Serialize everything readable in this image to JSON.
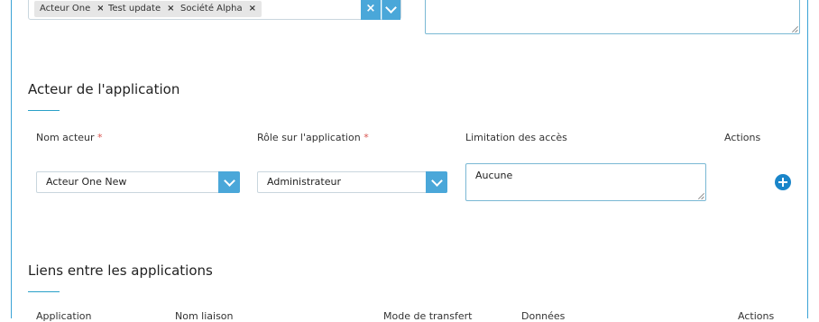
{
  "top": {
    "tags": [
      "Acteur One",
      "Test update",
      "Société Alpha"
    ],
    "tag_remove": "×"
  },
  "actors_section": {
    "title": "Acteur de l'application",
    "headers": {
      "name": "Nom acteur",
      "role": "Rôle sur l'application",
      "limit": "Limitation des accès",
      "actions": "Actions"
    },
    "required_mark": "*",
    "row": {
      "name": "Acteur One New",
      "role": "Administrateur",
      "limit": "Aucune"
    }
  },
  "links_section": {
    "title": "Liens entre les applications",
    "headers": [
      "Application",
      "Nom liaison",
      "Mode de transfert",
      "Données",
      "Actions"
    ]
  },
  "colors": {
    "accent": "#4aa7d9",
    "add_button": "#1a85c9",
    "required": "#d9534f"
  }
}
